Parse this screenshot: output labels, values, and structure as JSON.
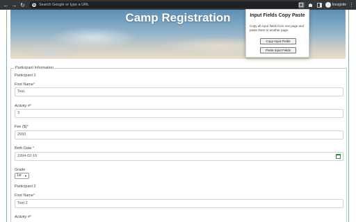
{
  "browser": {
    "omnibox_placeholder": "Search Google or type a URL",
    "profile_label": "Incognito"
  },
  "page": {
    "title": "Camp Registration",
    "fieldset_legend": "Participant Information",
    "participants": [
      {
        "heading": "Participant 1",
        "first_name_label": "First Name",
        "first_name_value": "Test",
        "activity_label": "Activity #",
        "activity_value": "3",
        "fee_label": "Fee ($)",
        "fee_value": "2550",
        "birth_label": "Birth Date",
        "birth_value": "1994-02-16",
        "grade_label": "Grade",
        "grade_value": "1st"
      },
      {
        "heading": "Participant 2",
        "first_name_label": "First Name",
        "first_name_value": "Test 2",
        "activity_label": "Activity #"
      }
    ],
    "required_marker": "*"
  },
  "popup": {
    "title": "Input Fields Copy Paste",
    "description": "Copy all input fields from one page and paste them to another page.",
    "copy_button": "Copy Input Fields",
    "paste_button": "Paste Input Fields"
  }
}
